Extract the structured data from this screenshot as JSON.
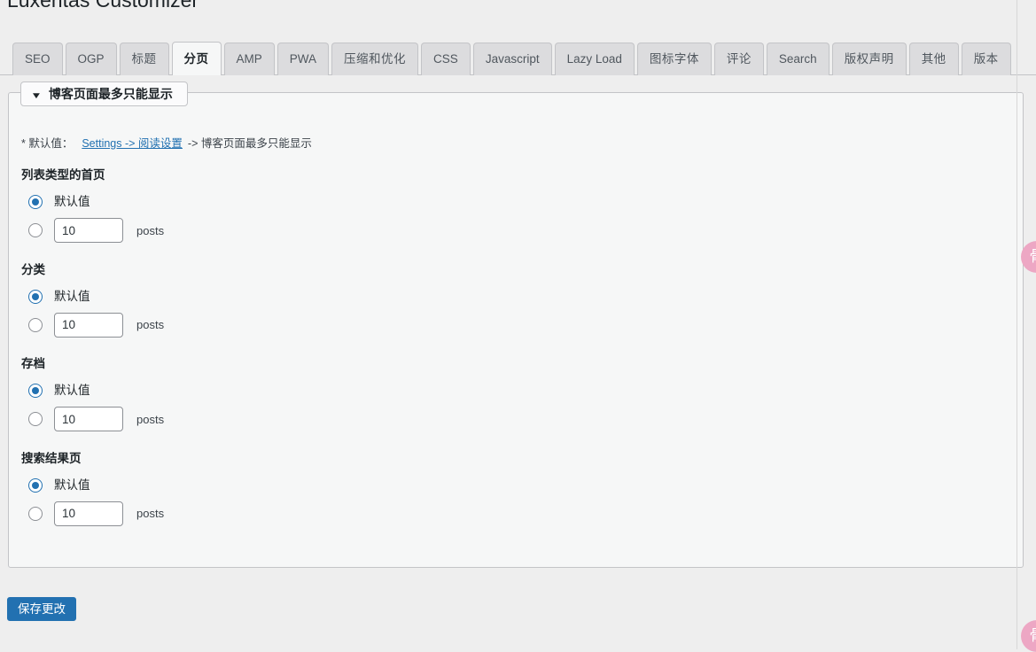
{
  "header": {
    "title": "Luxeritas Customizer"
  },
  "tabs": [
    {
      "label": "SEO",
      "active": false,
      "cjk": false
    },
    {
      "label": "OGP",
      "active": false,
      "cjk": false
    },
    {
      "label": "标题",
      "active": false,
      "cjk": true
    },
    {
      "label": "分页",
      "active": true,
      "cjk": true
    },
    {
      "label": "AMP",
      "active": false,
      "cjk": false
    },
    {
      "label": "PWA",
      "active": false,
      "cjk": false
    },
    {
      "label": "压缩和优化",
      "active": false,
      "cjk": true
    },
    {
      "label": "CSS",
      "active": false,
      "cjk": false
    },
    {
      "label": "Javascript",
      "active": false,
      "cjk": false
    },
    {
      "label": "Lazy Load",
      "active": false,
      "cjk": false
    },
    {
      "label": "图标字体",
      "active": false,
      "cjk": true
    },
    {
      "label": "评论",
      "active": false,
      "cjk": true
    },
    {
      "label": "Search",
      "active": false,
      "cjk": false
    },
    {
      "label": "版权声明",
      "active": false,
      "cjk": true
    },
    {
      "label": "其他",
      "active": false,
      "cjk": true
    },
    {
      "label": "版本",
      "active": false,
      "cjk": true
    }
  ],
  "panel": {
    "accordion": {
      "arrow_icon": "triangle-down-icon",
      "title": "博客页面最多只能显示"
    },
    "note": {
      "prefix": "* 默认值：",
      "link_text": "Settings -> 阅读设置",
      "suffix": "-> 博客页面最多只能显示"
    },
    "groups": [
      {
        "title": "列表类型的首页",
        "default_label": "默认值",
        "default_selected": true,
        "custom_selected": false,
        "value": "10",
        "unit": "posts"
      },
      {
        "title": "分类",
        "default_label": "默认值",
        "default_selected": true,
        "custom_selected": false,
        "value": "10",
        "unit": "posts"
      },
      {
        "title": "存档",
        "default_label": "默认值",
        "default_selected": true,
        "custom_selected": false,
        "value": "10",
        "unit": "posts"
      },
      {
        "title": "搜索结果页",
        "default_label": "默认值",
        "default_selected": true,
        "custom_selected": false,
        "value": "10",
        "unit": "posts"
      }
    ]
  },
  "footer": {
    "save_label": "保存更改"
  },
  "edge_badges": [
    {
      "glyph": "骨",
      "name": "floating-badge-top"
    },
    {
      "glyph": "骨",
      "name": "floating-badge-bottom"
    }
  ],
  "colors": {
    "accent": "#2271b1",
    "page_bg": "#eeeeee",
    "panel_bg": "#f6f7f7",
    "tab_inactive_bg": "#dcdcde",
    "badge_pink": "#eda7c4"
  }
}
